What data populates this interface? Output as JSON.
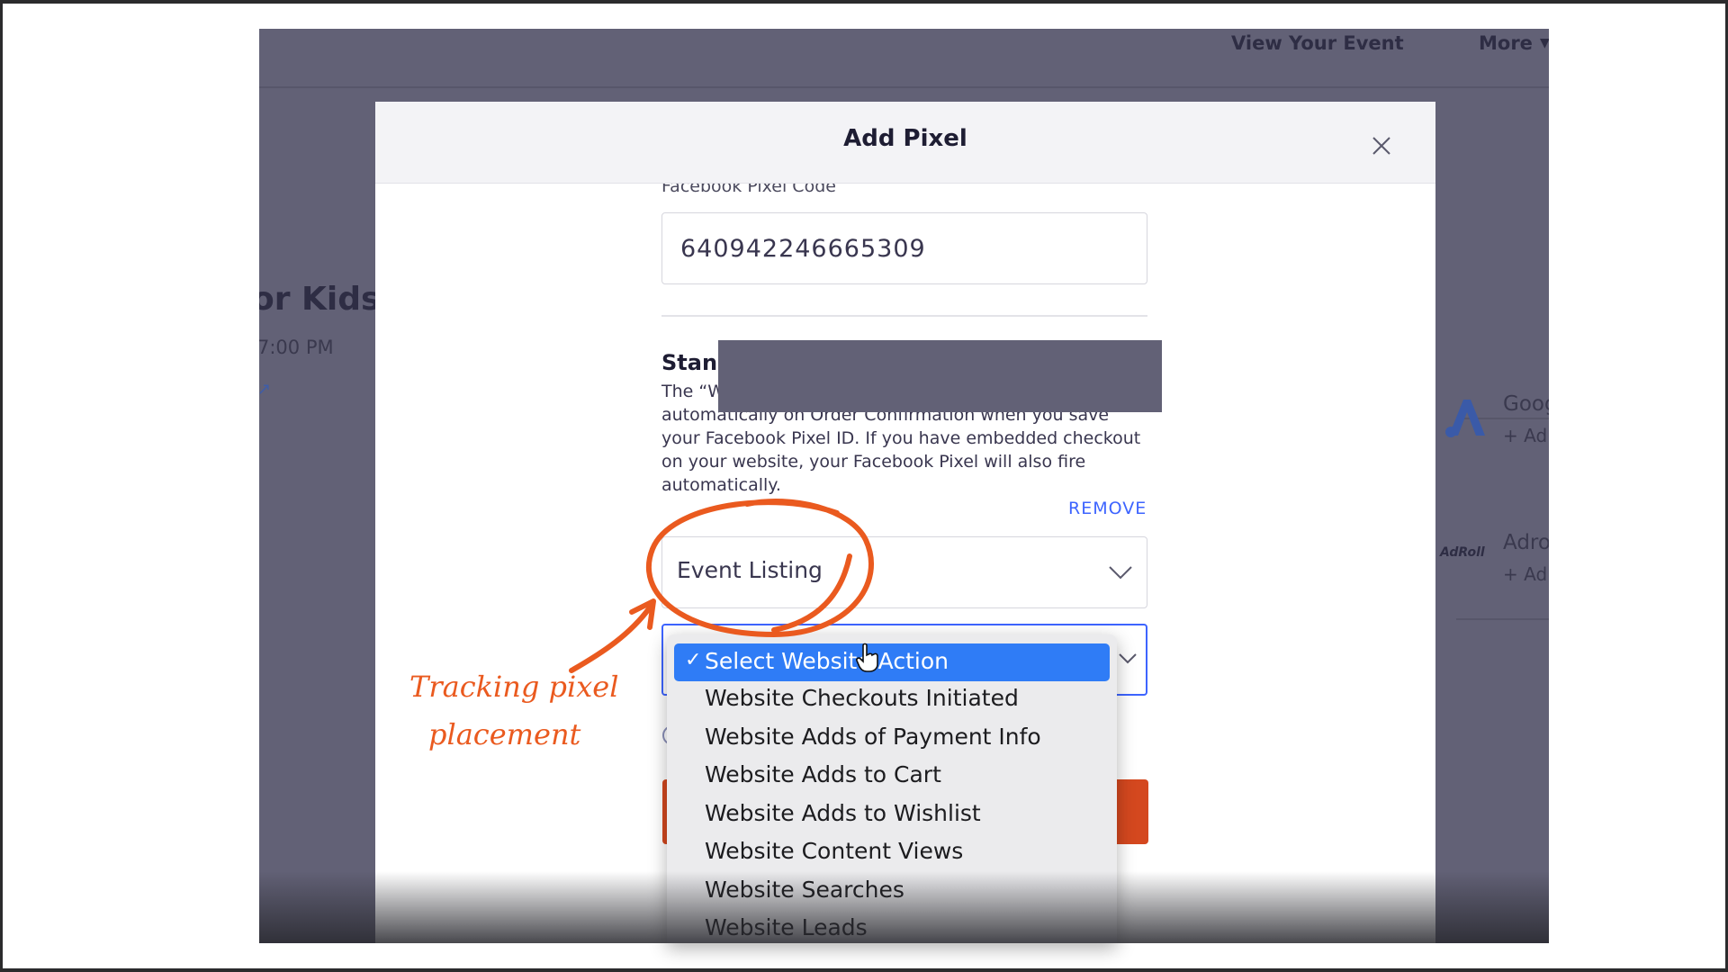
{
  "topnav": {
    "view_event": "View Your Event",
    "more": "More"
  },
  "background": {
    "event_title": "or Kids",
    "event_time": "7:00 PM",
    "partners": [
      {
        "name": "Goog",
        "add": "+ Ad"
      },
      {
        "name": "Adro",
        "add": "+ Ad"
      }
    ],
    "adroll_logo": "AdRoll"
  },
  "modal": {
    "title": "Add Pixel",
    "pixel_code_label": "Facebook Pixel Code",
    "pixel_code_value": "640942246665309",
    "standard_heading": "Stanc",
    "standard_desc_line1": "The “W",
    "standard_desc_rest": "automatically on Order Confirmation when you save your Facebook Pixel ID. If you have embedded checkout on your website, your Facebook Pixel will also fire automatically.",
    "remove_label": "REMOVE",
    "listing_value": "Event Listing"
  },
  "dropdown": {
    "selected_check": "✓",
    "selected": "Select Website Action",
    "options": [
      "Website Checkouts Initiated",
      "Website Adds of Payment Info",
      "Website Adds to Cart",
      "Website Adds to Wishlist",
      "Website Content Views",
      "Website Searches",
      "Website Leads"
    ]
  },
  "annotation": {
    "line1": "Tracking pixel",
    "line2": "placement"
  },
  "colors": {
    "overlay": "#626176",
    "accent_blue": "#3d64ff",
    "selected_blue": "#2f7cf6",
    "save_orange": "#d4481f",
    "annotation_orange": "#ea5a1f"
  }
}
